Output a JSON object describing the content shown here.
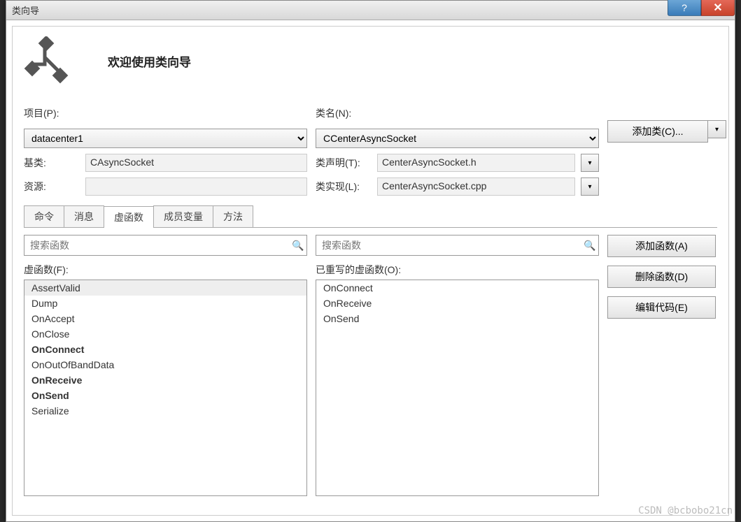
{
  "title": "类向导",
  "welcome": "欢迎使用类向导",
  "labels": {
    "project": "项目(P):",
    "class_name": "类名(N):",
    "base_class": "基类:",
    "class_decl": "类声明(T):",
    "resource": "资源:",
    "class_impl": "类实现(L):",
    "virtual_funcs": "虚函数(F):",
    "overridden": "已重写的虚函数(O):"
  },
  "project_value": "datacenter1",
  "class_value": "CCenterAsyncSocket",
  "base_value": "CAsyncSocket",
  "decl_value": "CenterAsyncSocket.h",
  "impl_value": "CenterAsyncSocket.cpp",
  "resource_value": "",
  "buttons": {
    "add_class": "添加类(C)...",
    "add_func": "添加函数(A)",
    "del_func": "删除函数(D)",
    "edit_code": "编辑代码(E)"
  },
  "tabs": [
    "命令",
    "消息",
    "虚函数",
    "成员变量",
    "方法"
  ],
  "active_tab": 2,
  "search_placeholder_l": "搜索函数",
  "search_placeholder_r": "搜索函数",
  "virtual_functions": [
    {
      "name": "AssertValid",
      "bold": false,
      "sel": true
    },
    {
      "name": "Dump",
      "bold": false,
      "sel": false
    },
    {
      "name": "OnAccept",
      "bold": false,
      "sel": false
    },
    {
      "name": "OnClose",
      "bold": false,
      "sel": false
    },
    {
      "name": "OnConnect",
      "bold": true,
      "sel": false
    },
    {
      "name": "OnOutOfBandData",
      "bold": false,
      "sel": false
    },
    {
      "name": "OnReceive",
      "bold": true,
      "sel": false
    },
    {
      "name": "OnSend",
      "bold": true,
      "sel": false
    },
    {
      "name": "Serialize",
      "bold": false,
      "sel": false
    }
  ],
  "overridden_functions": [
    {
      "name": "OnConnect"
    },
    {
      "name": "OnReceive"
    },
    {
      "name": "OnSend"
    }
  ],
  "watermark": "CSDN @bcbobo21cn"
}
